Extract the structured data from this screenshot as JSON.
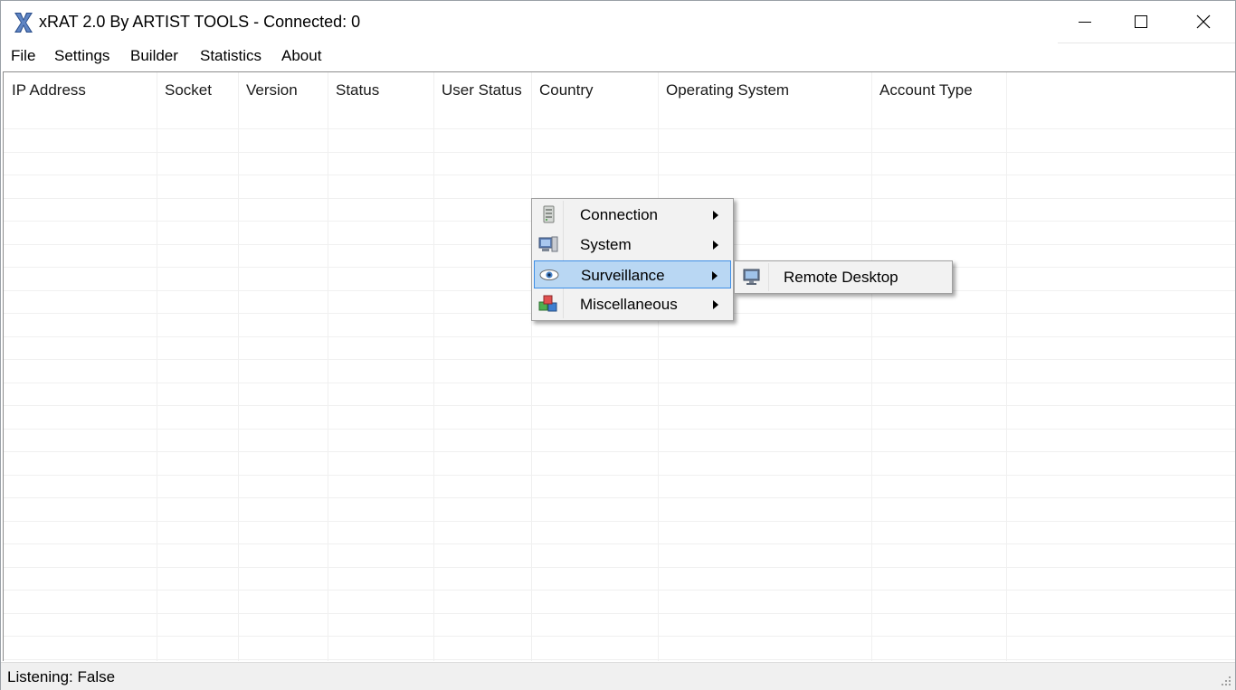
{
  "window": {
    "title": "xRAT 2.0 By ARTIST TOOLS - Connected: 0",
    "app_icon": "x-logo-icon"
  },
  "menubar": {
    "items": [
      {
        "label": "File"
      },
      {
        "label": "Settings"
      },
      {
        "label": "Builder"
      },
      {
        "label": "Statistics"
      },
      {
        "label": "About"
      }
    ]
  },
  "listview": {
    "columns": [
      {
        "label": "IP Address"
      },
      {
        "label": "Socket"
      },
      {
        "label": "Version"
      },
      {
        "label": "Status"
      },
      {
        "label": "User Status"
      },
      {
        "label": "Country"
      },
      {
        "label": "Operating System"
      },
      {
        "label": "Account Type"
      }
    ],
    "rows": []
  },
  "context_menu": {
    "items": [
      {
        "label": "Connection",
        "icon": "server-icon",
        "has_submenu": true
      },
      {
        "label": "System",
        "icon": "computer-icon",
        "has_submenu": true
      },
      {
        "label": "Surveillance",
        "icon": "eye-icon",
        "has_submenu": true,
        "selected": true
      },
      {
        "label": "Miscellaneous",
        "icon": "cubes-icon",
        "has_submenu": true
      }
    ],
    "submenu": {
      "items": [
        {
          "label": "Remote Desktop",
          "icon": "monitor-icon"
        }
      ]
    }
  },
  "statusbar": {
    "text": "Listening: False"
  },
  "colors": {
    "selection_fill": "#b9d7f3",
    "selection_border": "#3d8ee6",
    "menu_background": "#f2f2f2",
    "statusbar_background": "#f0f0f0"
  }
}
